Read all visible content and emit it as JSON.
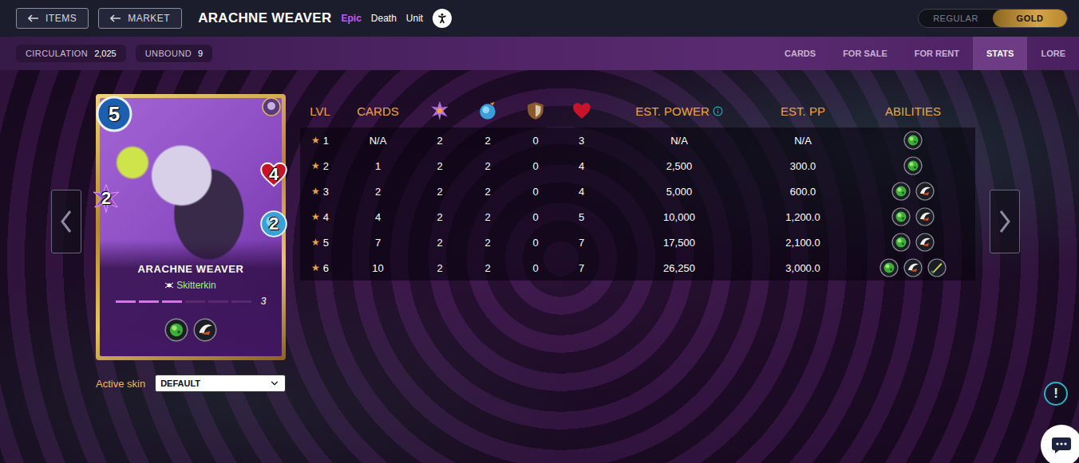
{
  "nav": {
    "buttons": [
      {
        "label": "ITEMS"
      },
      {
        "label": "MARKET"
      }
    ]
  },
  "header": {
    "title": "ARACHNE WEAVER",
    "rarity": "Epic",
    "element": "Death",
    "type": "Unit"
  },
  "edition_toggle": [
    {
      "label": "REGULAR",
      "selected": false
    },
    {
      "label": "GOLD",
      "selected": true
    }
  ],
  "stat_pills": [
    {
      "label": "CIRCULATION",
      "value": "2,025"
    },
    {
      "label": "UNBOUND",
      "value": "9"
    }
  ],
  "tabs": [
    {
      "label": "CARDS",
      "selected": false
    },
    {
      "label": "FOR SALE",
      "selected": false
    },
    {
      "label": "FOR RENT",
      "selected": false
    },
    {
      "label": "STATS",
      "selected": true
    },
    {
      "label": "LORE",
      "selected": false
    }
  ],
  "card": {
    "mana": "5",
    "name": "ARACHNE WEAVER",
    "tribe": "Skitterkin",
    "magic": "2",
    "health": "4",
    "speed": "2",
    "level": "3",
    "level_progress": 0.5,
    "abilities": [
      {
        "kind": "poison"
      },
      {
        "kind": "claw"
      }
    ]
  },
  "skin": {
    "label": "Active skin",
    "value": "DEFAULT"
  },
  "table": {
    "level_mark": "★",
    "columns": [
      {
        "label": "LVL",
        "kind": "text"
      },
      {
        "label": "CARDS",
        "kind": "text"
      },
      {
        "label": "",
        "kind": "magic"
      },
      {
        "label": "",
        "kind": "speed"
      },
      {
        "label": "",
        "kind": "armor"
      },
      {
        "label": "",
        "kind": "health"
      },
      {
        "label": "EST. POWER",
        "kind": "info"
      },
      {
        "label": "EST. PP",
        "kind": "text"
      },
      {
        "label": "ABILITIES",
        "kind": "text"
      }
    ],
    "rows": [
      {
        "level": "1",
        "cards": "N/A",
        "magic": "2",
        "speed": "2",
        "armor": "0",
        "health": "3",
        "power": "N/A",
        "pp": "N/A",
        "abilities": [
          {
            "kind": "poison"
          }
        ]
      },
      {
        "level": "2",
        "cards": "1",
        "magic": "2",
        "speed": "2",
        "armor": "0",
        "health": "4",
        "power": "2,500",
        "pp": "300.0",
        "abilities": [
          {
            "kind": "poison"
          }
        ]
      },
      {
        "level": "3",
        "cards": "2",
        "magic": "2",
        "speed": "2",
        "armor": "0",
        "health": "4",
        "power": "5,000",
        "pp": "600.0",
        "abilities": [
          {
            "kind": "poison"
          },
          {
            "kind": "claw"
          }
        ]
      },
      {
        "level": "4",
        "cards": "4",
        "magic": "2",
        "speed": "2",
        "armor": "0",
        "health": "5",
        "power": "10,000",
        "pp": "1,200.0",
        "abilities": [
          {
            "kind": "poison"
          },
          {
            "kind": "claw"
          }
        ]
      },
      {
        "level": "5",
        "cards": "7",
        "magic": "2",
        "speed": "2",
        "armor": "0",
        "health": "7",
        "power": "17,500",
        "pp": "2,100.0",
        "abilities": [
          {
            "kind": "poison"
          },
          {
            "kind": "claw"
          }
        ]
      },
      {
        "level": "6",
        "cards": "10",
        "magic": "2",
        "speed": "2",
        "armor": "0",
        "health": "7",
        "power": "26,250",
        "pp": "3,000.0",
        "abilities": [
          {
            "kind": "poison"
          },
          {
            "kind": "claw"
          },
          {
            "kind": "blade"
          }
        ]
      }
    ]
  },
  "help": {
    "label": "!"
  }
}
